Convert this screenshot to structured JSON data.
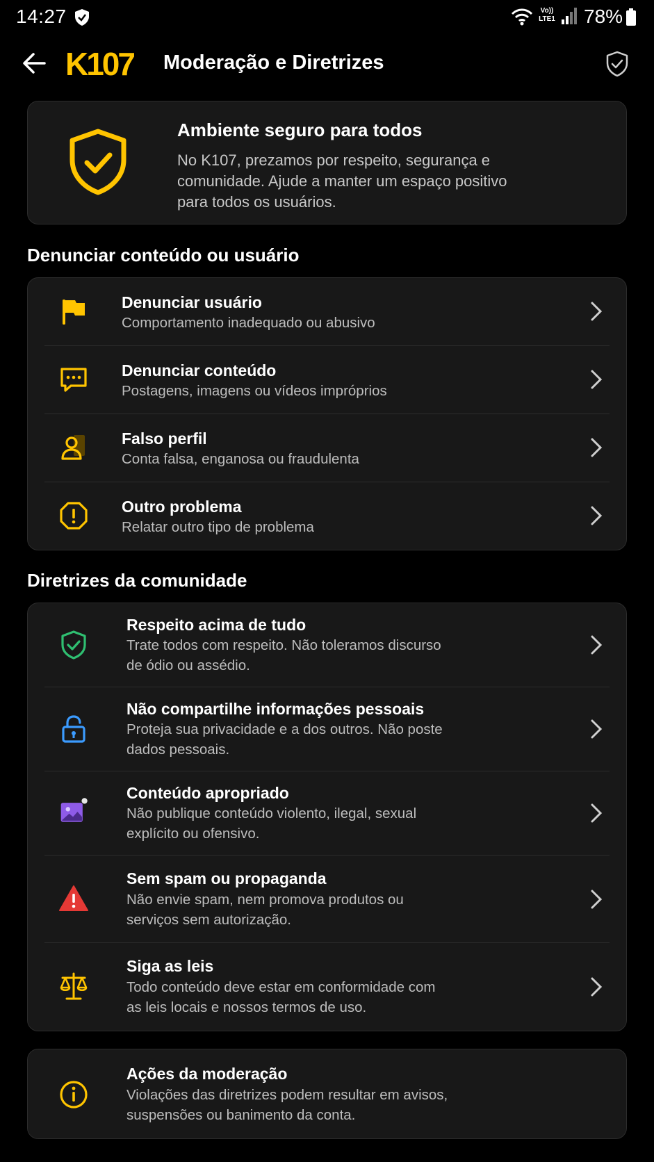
{
  "status_bar": {
    "time": "14:27",
    "volte_line1": "Vo))",
    "volte_line2": "LTE1",
    "battery": "78%",
    "icons": [
      "shield-icon",
      "wifi-icon",
      "signal-icon",
      "battery-icon"
    ]
  },
  "header": {
    "logo_text": "K107",
    "title": "Moderação e Diretrizes",
    "icons": [
      "back-arrow-icon",
      "shield-check-icon"
    ]
  },
  "colors": {
    "background": "#000000",
    "card": "#181818",
    "accent": "#FFC400",
    "green": "#2FBF71",
    "blue": "#3B9BFF",
    "purple": "#8E5BE8",
    "red": "#E53935",
    "subtext": "#BDBDBD"
  },
  "hero": {
    "title": "Ambiente seguro para todos",
    "text": "No K107, prezamos por respeito, segurança e comunidade. Ajude a manter um espaço positivo para todos os usuários."
  },
  "report_section": {
    "title": "Denunciar conteúdo ou usuário",
    "items": [
      {
        "title": "Denunciar usuário",
        "subtitle": "Comportamento inadequado ou abusivo",
        "icon": "flag-icon"
      },
      {
        "title": "Denunciar conteúdo",
        "subtitle": "Postagens, imagens ou vídeos impróprios",
        "icon": "chat-bubble-icon"
      },
      {
        "title": "Falso perfil",
        "subtitle": "Conta falsa, enganosa ou fraudulenta",
        "icon": "user-card-icon"
      },
      {
        "title": "Outro problema",
        "subtitle": "Relatar outro tipo de problema",
        "icon": "alert-octagon-icon"
      }
    ]
  },
  "guidelines_section": {
    "title": "Diretrizes da comunidade",
    "items": [
      {
        "title": "Respeito acima de tudo",
        "subtitle_1": "Trate todos com respeito. Não toleramos discurso",
        "subtitle_2": "de ódio ou assédio.",
        "icon": "shield-check-icon"
      },
      {
        "title": "Não compartilhe informações pessoais",
        "subtitle_1": "Proteja sua privacidade e a dos outros. Não poste",
        "subtitle_2": "dados pessoais.",
        "icon": "lock-icon"
      },
      {
        "title": "Conteúdo apropriado",
        "subtitle_1": "Não publique conteúdo violento, ilegal, sexual",
        "subtitle_2": "explícito ou ofensivo.",
        "icon": "image-icon"
      },
      {
        "title": "Sem spam ou propaganda",
        "subtitle_1": "Não envie spam, nem promova produtos ou",
        "subtitle_2": "serviços sem autorização.",
        "icon": "warning-triangle-icon"
      },
      {
        "title": "Siga as leis",
        "subtitle_1": "Todo conteúdo deve estar em conformidade com",
        "subtitle_2": "as leis locais e nossos termos de uso.",
        "icon": "scales-icon"
      }
    ]
  },
  "moderation_info": {
    "title": "Ações da moderação",
    "subtitle_1": "Violações das diretrizes podem resultar em avisos,",
    "subtitle_2": "suspensões ou banimento da conta.",
    "icon": "info-icon"
  }
}
